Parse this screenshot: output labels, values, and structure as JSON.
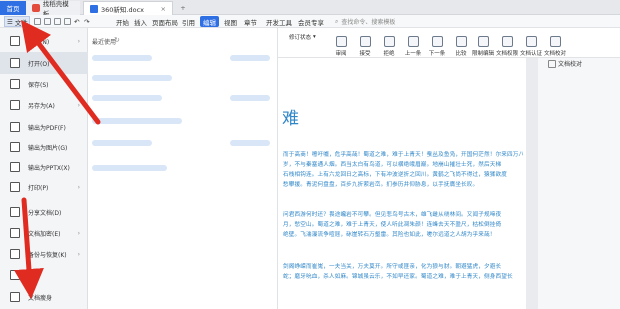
{
  "tabs": {
    "home": "首页",
    "template": "找稻壳模板",
    "document": "360新知.docx",
    "close": "×",
    "add": "+"
  },
  "menu": {
    "file": "文件",
    "items": [
      "开始",
      "插入",
      "页面布局",
      "引用",
      "审阅",
      "视图",
      "章节",
      "开发工具",
      "会员专享"
    ],
    "active": "编辑",
    "search_placeholder": "查找命令、搜索模板"
  },
  "ribbon": {
    "review_dropdown": "修订状态",
    "buttons": [
      "审阅",
      "接受",
      "拒绝",
      "上一条",
      "下一条",
      "比较",
      "限制编辑",
      "文档权限",
      "文档认证",
      "文档校对"
    ]
  },
  "file_menu": {
    "items": [
      {
        "label": "新建(N)",
        "has_sub": true
      },
      {
        "label": "打开(O)",
        "has_sub": false
      },
      {
        "label": "保存(S)",
        "has_sub": false
      },
      {
        "label": "另存为(A)",
        "has_sub": true
      },
      {
        "label": "输出为PDF(F)",
        "has_sub": false
      },
      {
        "label": "输出为图片(G)",
        "has_sub": false
      },
      {
        "label": "输出为PPTX(X)",
        "has_sub": false
      },
      {
        "label": "打印(P)",
        "has_sub": true
      },
      {
        "label": "分享文档(D)",
        "has_sub": false
      },
      {
        "label": "文档加密(E)",
        "has_sub": true
      },
      {
        "label": "备份与恢复(K)",
        "has_sub": true
      },
      {
        "label": "帮助",
        "has_sub": false
      },
      {
        "label": "文档瘦身",
        "has_sub": false
      }
    ],
    "recent_title": "最近使用"
  },
  "document": {
    "title": "难",
    "lines": [
      "而于高商！噫吁嚱，危乎高哉！蜀道之难，难于上青天！蚕丛及鱼凫，开国何茫然！尔来四万八",
      "岁，不与秦塞通人烟。西当太白有鸟道，可以横绝峨眉巅。地崩山摧壮士死，然后天梯",
      "石栈相钩连。上有六龙回日之高标，下有冲波逆折之回川。黄鹤之飞尚不得过，猿猱欲度",
      "愁攀援。青泥何盘盘，百步九折萦岩峦。扪参历井仰胁息，以手抚膺坐长叹。",
      "",
      "问君西游何时还？畏途巉岩不可攀。但见悲鸟号古木，雄飞雌从绕林间。又闻子规啼夜",
      "月，愁空山。蜀道之难，难于上青天，使人听此凋朱颜！连峰去天不盈尺，枯松倒挂倚",
      "绝壁。飞湍瀑流争喧豗，砯崖转石万壑雷。其险也如此，嗟尔远道之人胡为乎来哉！",
      "",
      "剑阁峥嵘而崔嵬，一夫当关，万夫莫开。所守或匪亲，化为狼与豺。朝避猛虎，夕避长",
      "蛇；磨牙吮血，杀人如麻。锦城虽云乐，不如早还家。蜀道之难，难于上青天，侧身西望长"
    ]
  },
  "right_panel": {
    "title": "文档校对"
  },
  "colors": {
    "accent": "#2f6fe4",
    "doc_text": "#2f86c8",
    "arrow": "#e02b20"
  }
}
